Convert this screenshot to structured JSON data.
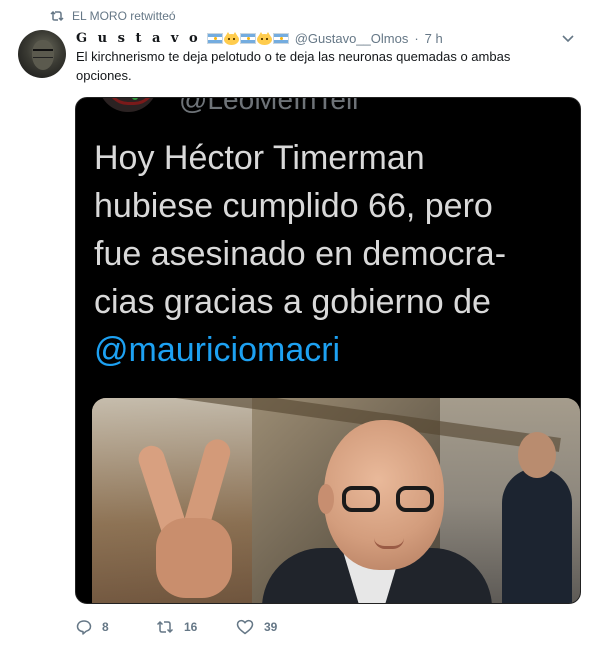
{
  "retweet_context": {
    "label": "EL MORO retwitteó",
    "icon": "retweet-icon"
  },
  "author": {
    "display_name": "G u s t a v o",
    "emojis": [
      "flag-argentina",
      "cat-face",
      "flag-argentina",
      "cat-face",
      "flag-argentina"
    ],
    "handle": "@Gustavo__Olmos",
    "separator": "·",
    "time": "7 h",
    "avatar": "user-avatar"
  },
  "tweet": {
    "text": "El kirchnerismo te deja pelotudo o te deja las neuronas quemadas o ambas opciones."
  },
  "embedded_image": {
    "partial_handle": "@LeoMeInTell",
    "lines": [
      "Hoy Héctor Timerman",
      "hubiese cumplido 66, pero",
      "fue asesinado en democra-",
      "cias gracias a gobierno de"
    ],
    "mention": "@mauriciomacri",
    "colors": {
      "background": "#000000",
      "text": "#d9d9d9",
      "mention": "#1da1f2"
    }
  },
  "actions": {
    "reply": {
      "icon": "reply-icon",
      "count": "8"
    },
    "retweet": {
      "icon": "retweet-icon",
      "count": "16"
    },
    "like": {
      "icon": "heart-icon",
      "count": "39"
    }
  },
  "colors": {
    "secondary_text": "#657786",
    "primary_text": "#14171a",
    "link": "#1da1f2"
  }
}
